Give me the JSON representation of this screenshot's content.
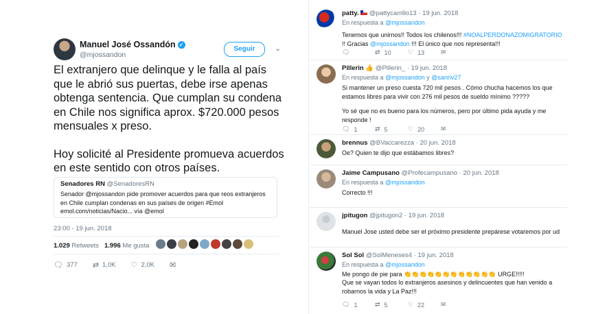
{
  "main_tweet": {
    "author_name": "Manuel José Ossandón",
    "verified_mark": "✓",
    "handle": "@mjossandon",
    "follow_label": "Seguir",
    "menu_glyph": "⌄",
    "text_p1": "El extranjero que delinque y le falla al país que le abrió sus puertas, debe irse apenas obtenga sentencia. Que cumplan su condena en Chile nos significa aprox. $720.000 pesos mensuales x preso.",
    "text_p2": "Hoy solicité al Presidente promueva acuerdos en este sentido con otros países.",
    "quote": {
      "name": "Senadores RN",
      "handle": "@SenadoresRN",
      "text": "Senador @mjossandon pide promover acuerdos para que reos extranjeros en Chile cumplan condenas en sus países de origen #Emol emol.com/noticias/Nacio... vía @emol"
    },
    "timestamp": "23:00 - 19 jun. 2018",
    "retweets_count": "1.029",
    "retweets_label": "Retweets",
    "likes_count": "1.996",
    "likes_label": "Me gusta",
    "reply_count": "377",
    "retweet_count": "1,0K",
    "like_count": "2,0K",
    "colors": {
      "accent": "#1da1f2",
      "text": "#14171a",
      "muted": "#657786"
    }
  },
  "replies": [
    {
      "name": "patty.",
      "handle": "@pattycarrillo13",
      "date": "· 19 jun. 2018",
      "to_prefix": "En respuesta a",
      "to": "@mjossandon",
      "text_a": "Tenemos que unirnos!!  Todos los chilenos!!! ",
      "hashtag": "#NOALPERDONAZOMIGRATORIO",
      "text_b": "!! Gracias ",
      "mention": "@mjossandon",
      "text_c": " !!! El único que nos representa!!!",
      "retweets": "10",
      "likes": "13"
    },
    {
      "name": "Pillerin",
      "name_emoji": "👍",
      "handle": "@Pillerin_",
      "date": "· 19 jun. 2018",
      "to_prefix": "En respuesta a",
      "to": "@mjossandon",
      "to_and": "y",
      "to2": "@sanriv27",
      "text1": "Si mantener un preso cuesta 720 mil pesos . Cómo chucha hacemos los que estamos  libres para vivir con 276 mil pesos de sueldo mínimo ?????",
      "text2": "Yo sé que no es bueno para los números, pero por último pida ayuda y me responde !",
      "replies": "1",
      "retweets": "5",
      "likes": "20"
    },
    {
      "name": "brennus",
      "handle": "@BVaccarezza",
      "date": "· 20 jun. 2018",
      "text": "Oe? Quien te dijo que estábamos libres?"
    },
    {
      "name": "Jaime Campusano",
      "handle": "@Profecampusano",
      "date": "· 20 jun. 2018",
      "to_prefix": "En respuesta a",
      "to": "@mjossandon",
      "text": "Correcto !!!"
    },
    {
      "name": "jpitugon",
      "handle": "@jpitugon2",
      "date": "· 19 jun. 2018",
      "text": "Manuel Jose usted debe ser el próximo presidente prepárese votaremos por ud"
    },
    {
      "name": "Sol Sol",
      "handle": "@SolMeneses4",
      "date": "· 19 jun. 2018",
      "to_prefix": "En respuesta a",
      "to": "@mjossandon",
      "text_a": "Me  pongo de pie para ",
      "claps": "👏👏👏👏👏👏👏👏👏👏👏👏",
      "text_b": " URGE!!!!!",
      "text2": "Que se vayan todos lo extranjeros asesinos y delincuentes que han venido a robarnos la vida y La Paz!!!",
      "replies": "1",
      "retweets": "5",
      "likes": "22"
    }
  ],
  "icons": {
    "reply": "reply-icon",
    "retweet": "retweet-icon",
    "like": "heart-icon",
    "dm": "envelope-icon"
  },
  "glyphs": {
    "reply": "🗨",
    "retweet": "⇄",
    "like": "♡",
    "dm": "✉"
  }
}
